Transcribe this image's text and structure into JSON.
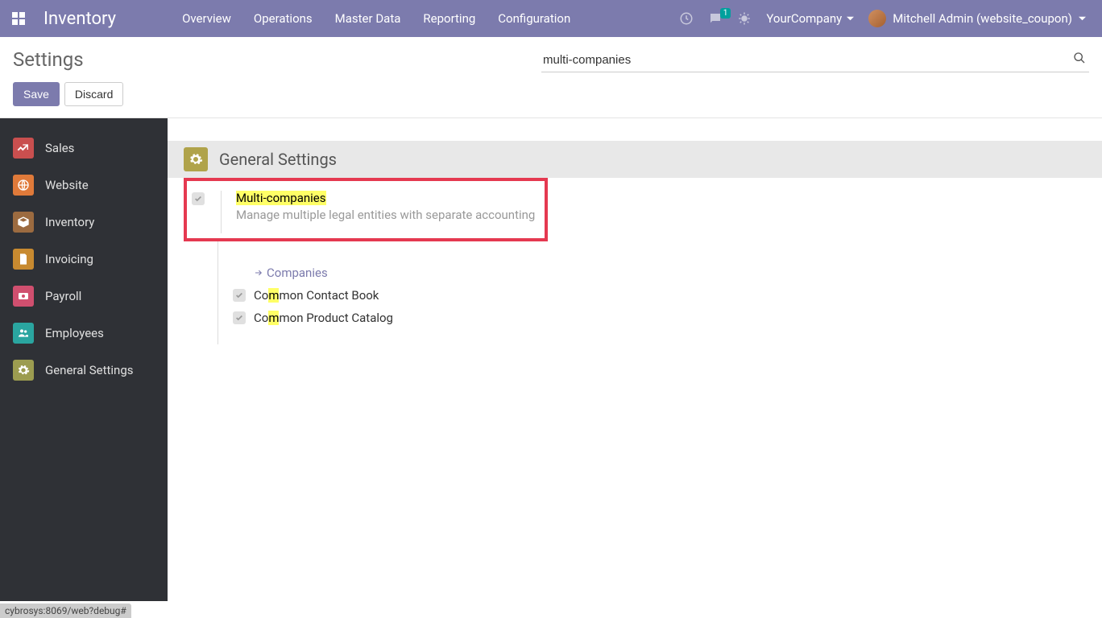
{
  "navbar": {
    "brand": "Inventory",
    "menu": [
      "Overview",
      "Operations",
      "Master Data",
      "Reporting",
      "Configuration"
    ],
    "messages_badge": "1",
    "company": "YourCompany",
    "user": "Mitchell Admin (website_coupon)"
  },
  "controlbar": {
    "title": "Settings",
    "save": "Save",
    "discard": "Discard",
    "search_value": "multi-companies"
  },
  "sidebar": {
    "items": [
      {
        "label": "Sales"
      },
      {
        "label": "Website"
      },
      {
        "label": "Inventory"
      },
      {
        "label": "Invoicing"
      },
      {
        "label": "Payroll"
      },
      {
        "label": "Employees"
      },
      {
        "label": "General Settings"
      }
    ]
  },
  "section": {
    "title": "General Settings"
  },
  "setting": {
    "title_pre": "Multi-co",
    "title_m": "m",
    "title_post": "panies",
    "desc": "Manage multiple legal entities with separate accounting",
    "companies_link": "Companies",
    "contact_pre": "Co",
    "contact_m": "m",
    "contact_post": "mon Contact Book",
    "catalog_pre": "Co",
    "catalog_m": "m",
    "catalog_post": "mon Product Catalog"
  },
  "statusbar": "cybrosys:8069/web?debug#"
}
